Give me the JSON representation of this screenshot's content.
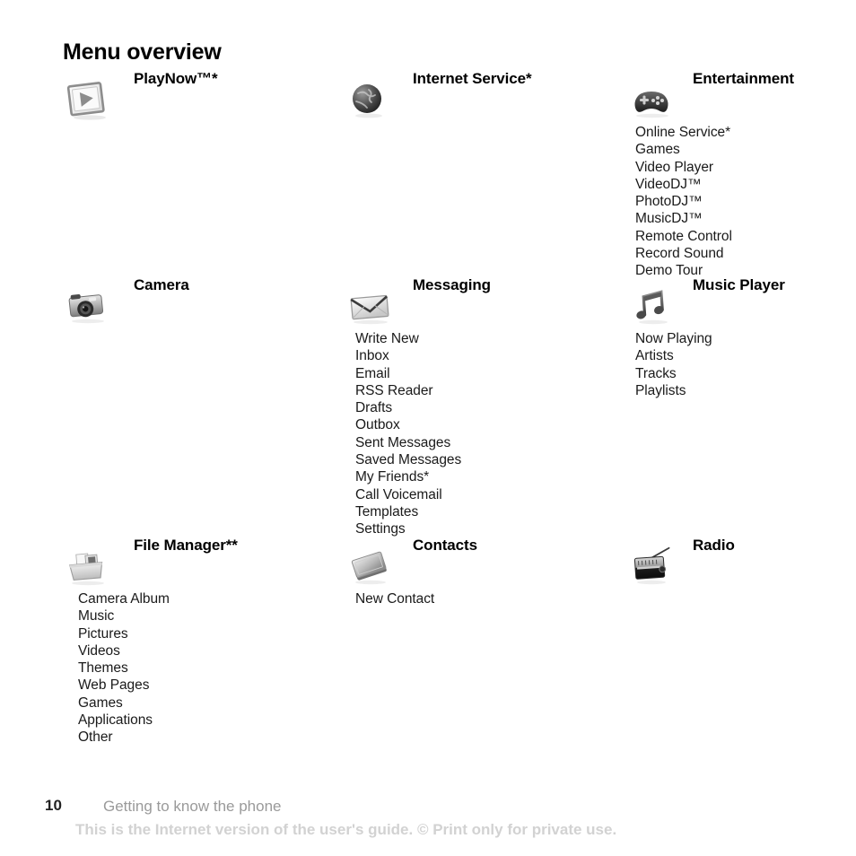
{
  "title": "Menu overview",
  "sections": [
    {
      "heading": "PlayNow™*",
      "icon": "playnow-icon",
      "items": []
    },
    {
      "heading": "Internet Service*",
      "icon": "globe-icon",
      "items": []
    },
    {
      "heading": "Entertainment",
      "icon": "gamepad-icon",
      "items": [
        "Online Service*",
        "Games",
        "Video Player",
        "VideoDJ™",
        "PhotoDJ™",
        "MusicDJ™",
        "Remote Control",
        "Record Sound",
        "Demo Tour"
      ]
    },
    {
      "heading": "Camera",
      "icon": "camera-icon",
      "items": []
    },
    {
      "heading": "Messaging",
      "icon": "envelope-icon",
      "items": [
        "Write New",
        "Inbox",
        "Email",
        "RSS Reader",
        "Drafts",
        "Outbox",
        "Sent Messages",
        "Saved Messages",
        "My Friends*",
        "Call Voicemail",
        "Templates",
        "Settings"
      ]
    },
    {
      "heading": "Music Player",
      "icon": "music-note-icon",
      "items": [
        "Now Playing",
        "Artists",
        "Tracks",
        "Playlists"
      ]
    },
    {
      "heading": "File Manager**",
      "icon": "folder-icon",
      "items": [
        "Camera Album",
        "Music",
        "Pictures",
        "Videos",
        "Themes",
        "Web Pages",
        "Games",
        "Applications",
        "Other"
      ]
    },
    {
      "heading": "Contacts",
      "icon": "address-book-icon",
      "items": [
        "New Contact"
      ]
    },
    {
      "heading": "Radio",
      "icon": "radio-icon",
      "items": []
    }
  ],
  "footer": {
    "page_number": "10",
    "chapter": "Getting to know the phone",
    "watermark": "This is the Internet version of the user's guide. © Print only for private use."
  },
  "colors": {
    "text": "#000000",
    "subtext": "#1a1a1a",
    "chapter": "#9a9a9a",
    "watermark": "#d2d2d2",
    "background": "#ffffff"
  }
}
